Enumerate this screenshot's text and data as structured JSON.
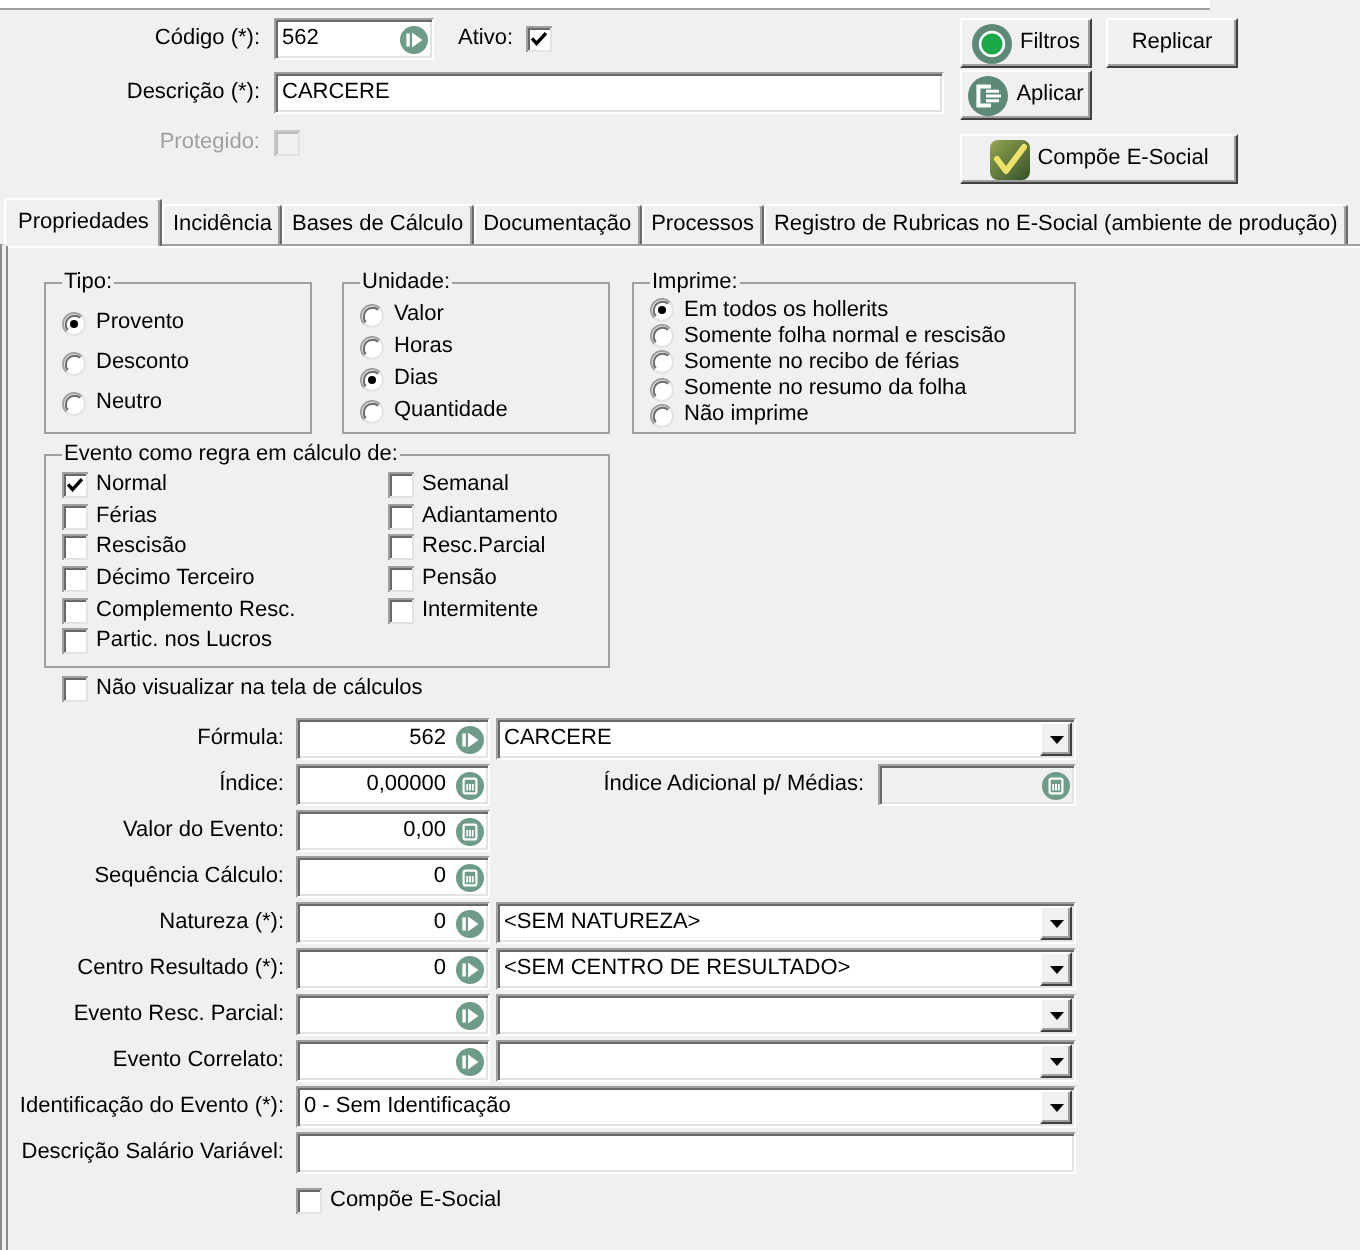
{
  "header": {
    "codigo": {
      "label": "Código (*):",
      "value": "562"
    },
    "ativo": {
      "label": "Ativo:",
      "checked": true
    },
    "descricao": {
      "label": "Descrição (*):",
      "value": "CARCERE"
    },
    "protegido": {
      "label": "Protegido:",
      "checked": false,
      "disabled": true
    },
    "buttons": [
      {
        "kind": "filter",
        "label": "Filtros"
      },
      {
        "kind": "replicate",
        "label": "Replicar"
      },
      {
        "kind": "apply",
        "label": "Aplicar"
      },
      {
        "kind": "esocial",
        "label": "Compõe E-Social"
      }
    ]
  },
  "tabs": [
    {
      "label": "Propriedades",
      "selected": true
    },
    {
      "label": "Incidência",
      "selected": false
    },
    {
      "label": "Bases de Cálculo",
      "selected": false
    },
    {
      "label": "Documentação",
      "selected": false
    },
    {
      "label": "Processos",
      "selected": false
    },
    {
      "label": "Registro de Rubricas no E-Social (ambiente de produção)",
      "selected": false
    }
  ],
  "properties": {
    "tipo": {
      "title": "Tipo:",
      "options": [
        {
          "label": "Provento",
          "selected": true
        },
        {
          "label": "Desconto",
          "selected": false
        },
        {
          "label": "Neutro",
          "selected": false
        }
      ]
    },
    "unidade": {
      "title": "Unidade:",
      "options": [
        {
          "label": "Valor",
          "selected": false
        },
        {
          "label": "Horas",
          "selected": false
        },
        {
          "label": "Dias",
          "selected": true
        },
        {
          "label": "Quantidade",
          "selected": false
        }
      ]
    },
    "imprime": {
      "title": "Imprime:",
      "options": [
        {
          "label": "Em todos os hollerits",
          "selected": true
        },
        {
          "label": "Somente folha normal e rescisão",
          "selected": false
        },
        {
          "label": "Somente no recibo de férias",
          "selected": false
        },
        {
          "label": "Somente no resumo da folha",
          "selected": false
        },
        {
          "label": "Não imprime",
          "selected": false
        }
      ]
    },
    "evento_regra": {
      "title": "Evento como regra em cálculo de:",
      "columns": [
        {
          "items": [
            {
              "label": "Normal",
              "checked": true
            },
            {
              "label": "Férias",
              "checked": false
            },
            {
              "label": "Rescisão",
              "checked": false
            },
            {
              "label": "Décimo Terceiro",
              "checked": false
            },
            {
              "label": "Complemento Resc.",
              "checked": false
            },
            {
              "label": "Partic. nos Lucros",
              "checked": false
            }
          ]
        },
        {
          "items": [
            {
              "label": "Semanal",
              "checked": false
            },
            {
              "label": "Adiantamento",
              "checked": false
            },
            {
              "label": "Resc.Parcial",
              "checked": false
            },
            {
              "label": "Pensão",
              "checked": false
            },
            {
              "label": "Intermitente",
              "checked": false
            }
          ]
        }
      ]
    },
    "nao_visualizar": {
      "label": "Não visualizar na tela de cálculos",
      "checked": false
    },
    "fields": [
      {
        "kind": "lookup",
        "label": "Fórmula:",
        "code": "562",
        "selection": "CARCERE"
      },
      {
        "kind": "number",
        "label": "Índice:",
        "value": "0,00000",
        "extra": {
          "label": "Índice Adicional p/ Médias:",
          "disabled": true
        }
      },
      {
        "kind": "number",
        "label": "Valor do Evento:",
        "value": "0,00"
      },
      {
        "kind": "number",
        "label": "Sequência Cálculo:",
        "value": "0"
      },
      {
        "kind": "lookup",
        "label": "Natureza (*):",
        "code": "0",
        "selection": "<SEM NATUREZA>"
      },
      {
        "kind": "lookup",
        "label": "Centro Resultado (*):",
        "code": "0",
        "selection": "<SEM CENTRO DE RESULTADO>"
      },
      {
        "kind": "lookup",
        "label": "Evento Resc. Parcial:"
      },
      {
        "kind": "lookup",
        "label": "Evento Correlato:"
      },
      {
        "kind": "select",
        "label": "Identificação do Evento (*):",
        "selection": "0 - Sem Identificação"
      },
      {
        "kind": "text",
        "label": "Descrição Salário Variável:"
      }
    ],
    "compoe_esocial": {
      "label": "Compõe E-Social",
      "checked": false
    }
  }
}
